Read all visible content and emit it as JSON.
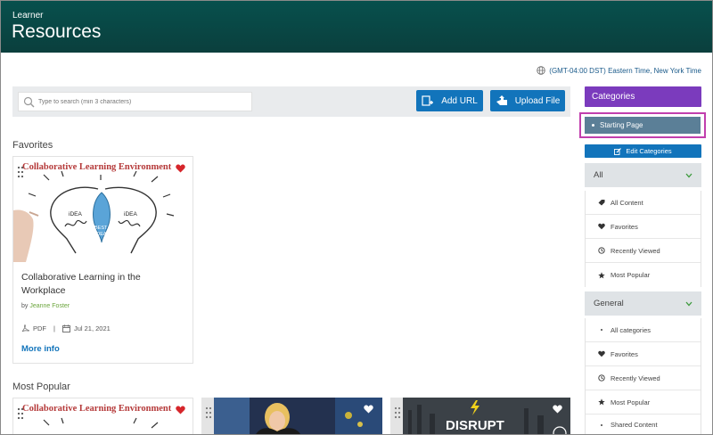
{
  "header": {
    "subtitle": "Learner",
    "title": "Resources"
  },
  "timezone": {
    "label": "(GMT-04:00 DST) Eastern Time, New York Time",
    "icon": "globe-icon"
  },
  "search": {
    "placeholder": "Type to search (min 3 characters)",
    "icon": "search-icon"
  },
  "toolbar": {
    "add_url_label": "Add URL",
    "upload_file_label": "Upload File"
  },
  "sections": {
    "favorites": "Favorites",
    "most_popular": "Most Popular"
  },
  "favorites_card": {
    "thumb_text": "Collaborative Learning Environment",
    "bulb_left": "iDEA",
    "bulb_center_1": "BEST",
    "bulb_center_2": "iDEA",
    "bulb_right": "iDEA",
    "title": "Collaborative Learning in the Workplace",
    "by_prefix": "by",
    "author": "Jeanne Foster",
    "type": "PDF",
    "separator": "|",
    "date": "Jul 21, 2021",
    "more_info": "More info"
  },
  "popular_cards": [
    {
      "thumb_text": "Collaborative Learning Environment"
    },
    {
      "thumb_text": ""
    },
    {
      "thumb_text": "DISRUPT"
    }
  ],
  "sidebar": {
    "categories_label": "Categories",
    "starting_page": "Starting Page",
    "edit_categories": "Edit Categories",
    "groups": [
      {
        "label": "All",
        "items": [
          {
            "label": "All Content",
            "icon": "tag-icon"
          },
          {
            "label": "Favorites",
            "icon": "heart-icon"
          },
          {
            "label": "Recently Viewed",
            "icon": "history-icon"
          },
          {
            "label": "Most Popular",
            "icon": "star-icon"
          }
        ]
      },
      {
        "label": "General",
        "items": [
          {
            "label": "All categories",
            "icon": "dot-icon"
          },
          {
            "label": "Favorites",
            "icon": "heart-icon"
          },
          {
            "label": "Recently Viewed",
            "icon": "history-icon"
          },
          {
            "label": "Most Popular",
            "icon": "star-icon"
          },
          {
            "label": "Shared Content",
            "icon": "dot-icon"
          }
        ]
      }
    ]
  },
  "colors": {
    "header": "#07504d",
    "primary_button": "#1274bb",
    "categories_header": "#7b3bbd",
    "highlight_border": "#c13fae",
    "starting_page_bg": "#5b7f97",
    "author_link": "#6ba53c",
    "favorite_heart": "#d6262b"
  }
}
